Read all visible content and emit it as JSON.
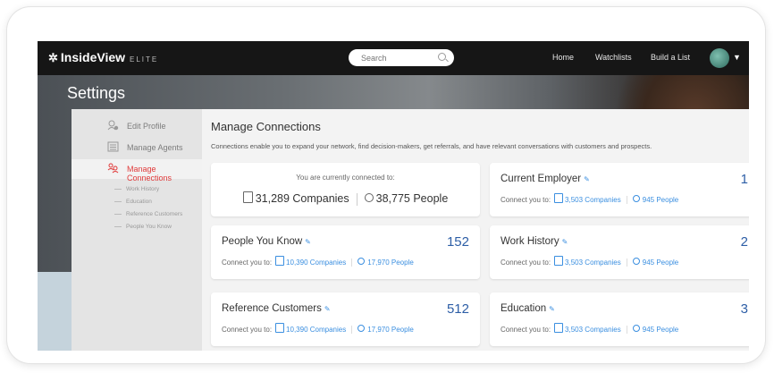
{
  "topbar": {
    "logo": "InsideView",
    "logo_tier": "ELITE",
    "search_placeholder": "Search",
    "nav": [
      "Home",
      "Watchlists",
      "Build a List"
    ]
  },
  "page_title": "Settings",
  "sidebar": {
    "items": [
      {
        "label": "Edit Profile",
        "icon": "edit-profile-icon"
      },
      {
        "label": "Manage Agents",
        "icon": "agents-icon"
      },
      {
        "label": "Manage Connections",
        "icon": "connections-icon",
        "active": true
      }
    ],
    "subitems": [
      "Work History",
      "Education",
      "Reference Customers",
      "People You Know"
    ]
  },
  "main": {
    "heading": "Manage Connections",
    "description": "Connections enable you to expand your network, find decision-makers, get referrals, and have relevant conversations with customers and prospects.",
    "summary": {
      "label": "You are currently connected to:",
      "companies": "31,289 Companies",
      "people": "38,775 People"
    },
    "cards": [
      {
        "title": "Current Employer",
        "count": "1",
        "connect_label": "Connect you to:",
        "companies": "3,503 Companies",
        "people": "945 People"
      },
      {
        "title": "People You Know",
        "count": "152",
        "connect_label": "Connect you to:",
        "companies": "10,390 Companies",
        "people": "17,970 People"
      },
      {
        "title": "Work History",
        "count": "2",
        "connect_label": "Connect you to:",
        "companies": "3,503 Companies",
        "people": "945 People"
      },
      {
        "title": "Reference Customers",
        "count": "512",
        "connect_label": "Connect you to:",
        "companies": "10,390 Companies",
        "people": "17,970 People"
      },
      {
        "title": "Education",
        "count": "3",
        "connect_label": "Connect you to:",
        "companies": "3,503 Companies",
        "people": "945 People"
      }
    ]
  },
  "colors": {
    "accent_red": "#e03a3a",
    "link_blue": "#3b8fe0",
    "count_blue": "#2d5ea6"
  }
}
